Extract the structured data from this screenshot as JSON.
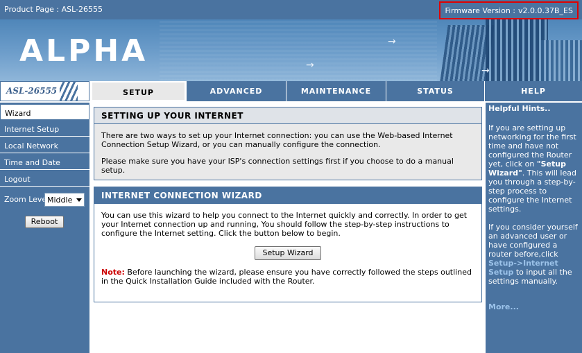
{
  "topbar": {
    "product_label": "Product Page : ASL-26555",
    "firmware_label": "Firmware Version :",
    "firmware_value": "v2.0.0.37B_ES"
  },
  "banner": {
    "logo": "ALPHA",
    "arrow": "→"
  },
  "model": "ASL-26555",
  "nav": {
    "setup": "SETUP",
    "advanced": "ADVANCED",
    "maintenance": "MAINTENANCE",
    "status": "STATUS",
    "help": "HELP"
  },
  "sidebar": {
    "items": [
      {
        "label": "Wizard"
      },
      {
        "label": "Internet Setup"
      },
      {
        "label": "Local Network"
      },
      {
        "label": "Time and Date"
      },
      {
        "label": "Logout"
      }
    ],
    "zoom_label": "Zoom Level:",
    "zoom_value": "Middle",
    "reboot_label": "Reboot"
  },
  "main": {
    "setup_title": "SETTING UP YOUR INTERNET",
    "setup_p1": "There are two ways to set up your Internet connection: you can use the Web-based Internet Connection Setup Wizard, or you can manually configure the connection.",
    "setup_p2": "Please make sure you have your ISP's connection settings first if you choose to do a manual setup.",
    "wizard_title": "INTERNET CONNECTION WIZARD",
    "wizard_p1": "You can use this wizard to help you connect to the Internet quickly and correctly. In order to get your Internet connection up and running, You should follow the step-by-step instructions to configure the Internet setting. Click the button below to begin.",
    "wizard_button": "Setup Wizard",
    "note_label": "Note:",
    "note_text": " Before launching the wizard, please ensure you have correctly followed the steps outlined in the Quick Installation Guide included with the Router."
  },
  "help": {
    "title": "Helpful Hints..",
    "p1_a": "If you are setting up networking for the first time and have not configured the Router yet, click on ",
    "p1_bold": "\"Setup Wizard\"",
    "p1_b": ". This will lead you through a step-by-step process to configure the Internet settings.",
    "p2_a": "If you consider yourself an advanced user or have configured a router before,click ",
    "p2_link": "Setup->Internet Setup",
    "p2_b": " to input all the settings manually.",
    "more": "More..."
  },
  "colors": {
    "brand_blue": "#4a73a0",
    "highlight_red": "#e00000",
    "note_red": "#cc0000",
    "help_link": "#9cc3ea"
  },
  "icons": [
    "arrow-icon",
    "dropdown-caret-icon"
  ]
}
